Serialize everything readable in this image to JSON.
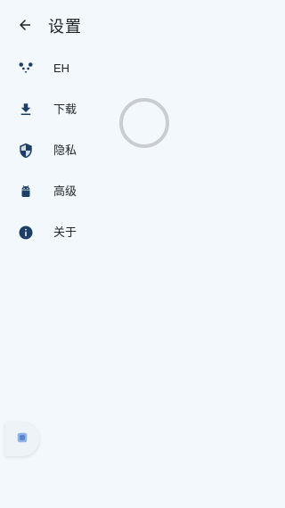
{
  "header": {
    "title": "设置",
    "back_icon": "arrow-left-icon"
  },
  "menu": {
    "items": [
      {
        "label": "EH",
        "icon": "panda-icon"
      },
      {
        "label": "下载",
        "icon": "download-icon"
      },
      {
        "label": "隐私",
        "icon": "shield-icon"
      },
      {
        "label": "高级",
        "icon": "android-icon"
      },
      {
        "label": "关于",
        "icon": "info-icon"
      }
    ]
  },
  "loading": {
    "icon": "loading-spinner"
  },
  "side_button": {
    "icon": "app-square-icon"
  },
  "colors": {
    "background": "#f3f8fd",
    "icon": "#1d3f66",
    "spinner": "#c9cdd1",
    "side_button_icon": "#8fb3e6"
  }
}
